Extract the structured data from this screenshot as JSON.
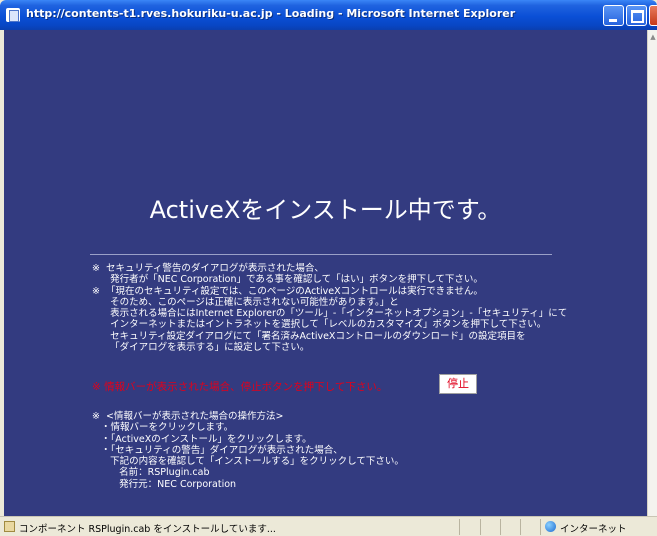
{
  "window": {
    "title": "http://contents-t1.rves.hokuriku-u.ac.jp - Loading - Microsoft Internet Explorer"
  },
  "content": {
    "headline": "ActiveXをインストール中です。",
    "notes": "※  セキュリティ警告のダイアログが表示された場合、\n      発行者が「NEC Corporation」である事を確認して「はい」ボタンを押下して下さい。\n※  「現在のセキュリティ設定では、このページのActiveXコントロールは実行できません。\n      そのため、このページは正確に表示されない可能性があります。」と\n      表示される場合にはInternet Explorerの「ツール」-「インターネットオプション」-「セキュリティ」にて\n      インターネットまたはイントラネットを選択して「レベルのカスタマイズ」ボタンを押下して下さい。\n      セキュリティ設定ダイアログにて「署名済みActiveXコントロールのダウンロード」の設定項目を\n      「ダイアログを表示する」に設定して下さい。",
    "warning": "※  情報バーが表示された場合、停止ボタンを押下して下さい。",
    "stop_button": "停止",
    "ops": "※  <情報バーが表示された場合の操作方法>\n   ・情報バーをクリックします。\n   ・「ActiveXのインストール」をクリックします。\n   ・「セキュリティの警告」ダイアログが表示された場合、\n      下記の内容を確認して「インストールする」をクリックして下さい。\n         名前：RSPlugin.cab\n         発行元：NEC Corporation"
  },
  "statusbar": {
    "text": "コンポーネント RSPlugin.cab をインストールしています...",
    "zone": "インターネット"
  },
  "colors": {
    "content_bg": "#333b80",
    "warning_red": "#e0001b",
    "titlebar_blue": "#0a4fd6"
  }
}
